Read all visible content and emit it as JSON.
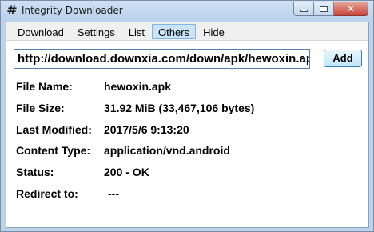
{
  "window": {
    "title": "Integrity Downloader",
    "icon": "hash-icon"
  },
  "menu": {
    "items": [
      {
        "label": "Download"
      },
      {
        "label": "Settings"
      },
      {
        "label": "List"
      },
      {
        "label": "Others",
        "active": true
      },
      {
        "label": "Hide"
      }
    ]
  },
  "url_field": {
    "value": "http://download.downxia.com/down/apk/hewoxin.apk"
  },
  "add_button": {
    "label": "Add"
  },
  "info": {
    "file_name_label": "File Name:",
    "file_name": "hewoxin.apk",
    "file_size_label": "File Size:",
    "file_size": "31.92 MiB (33,467,106 bytes)",
    "last_modified_label": "Last Modified:",
    "last_modified": "2017/5/6 9:13:20",
    "content_type_label": "Content Type:",
    "content_type": "application/vnd.android",
    "status_label": "Status:",
    "status": "200 - OK",
    "redirect_label": "Redirect to:",
    "redirect": "---"
  },
  "colors": {
    "frame": "#bdd3ec",
    "active_menu": "#cce4f7",
    "close_button": "#c7453a"
  }
}
